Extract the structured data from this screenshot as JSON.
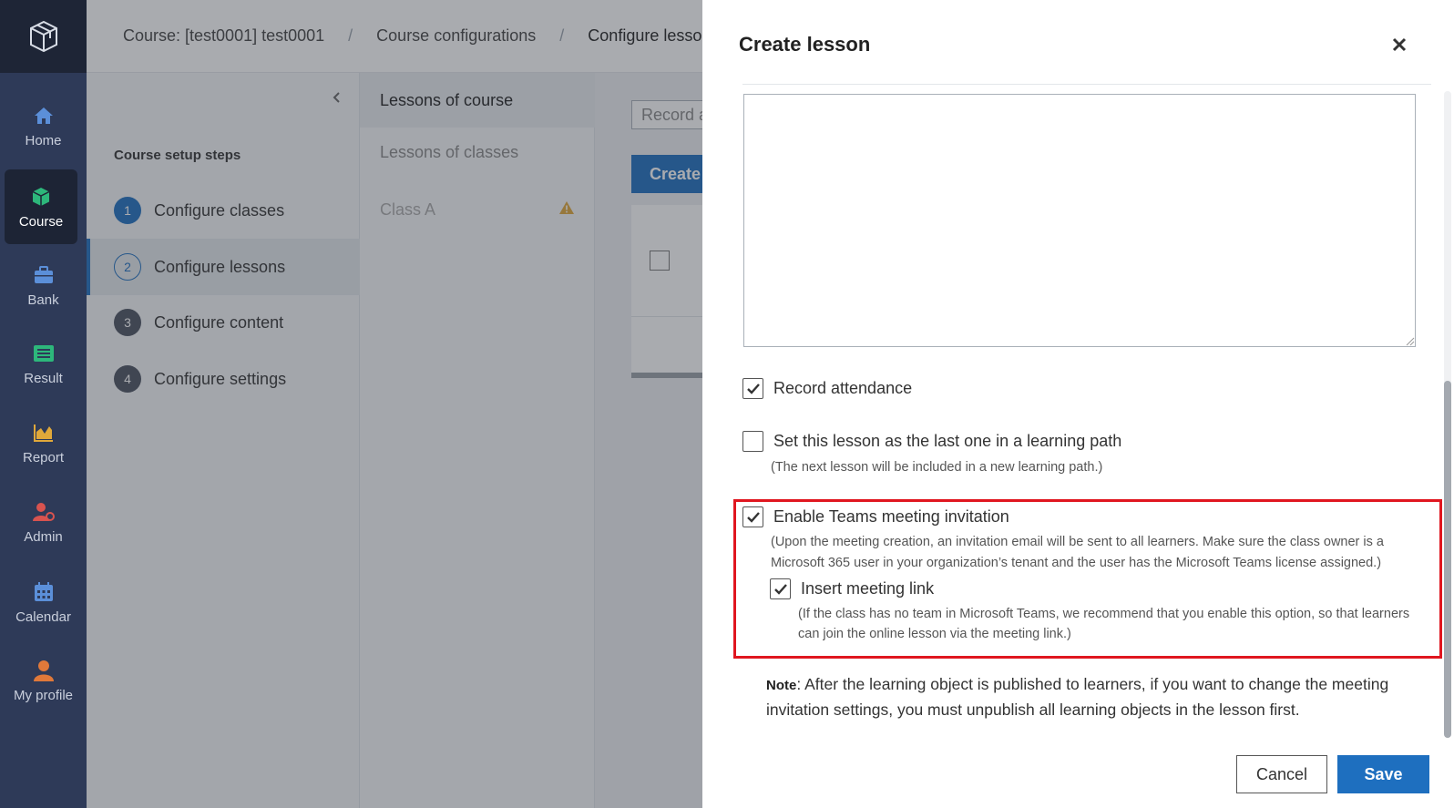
{
  "nav": {
    "items": [
      {
        "label": "Home",
        "icon": "home-icon",
        "color": "#5b8fd9"
      },
      {
        "label": "Course",
        "icon": "cube-icon",
        "color": "#2db77b"
      },
      {
        "label": "Bank",
        "icon": "briefcase-icon",
        "color": "#5b8fd9"
      },
      {
        "label": "Result",
        "icon": "list-icon",
        "color": "#2db77b"
      },
      {
        "label": "Report",
        "icon": "chart-icon",
        "color": "#e0a83a"
      },
      {
        "label": "Admin",
        "icon": "admin-icon",
        "color": "#d9534f"
      },
      {
        "label": "Calendar",
        "icon": "calendar-icon",
        "color": "#5b8fd9"
      },
      {
        "label": "My profile",
        "icon": "user-icon",
        "color": "#e0793a"
      }
    ]
  },
  "header": {
    "crumbs": [
      "Course: [test0001] test0001",
      "Course configurations",
      "Configure lessons"
    ]
  },
  "steps": {
    "title": "Course setup steps",
    "items": [
      {
        "num": "1",
        "label": "Configure classes"
      },
      {
        "num": "2",
        "label": "Configure lessons"
      },
      {
        "num": "3",
        "label": "Configure content"
      },
      {
        "num": "4",
        "label": "Configure settings"
      }
    ]
  },
  "lessons": {
    "tab_course": "Lessons of course",
    "tab_classes": "Lessons of classes",
    "class_a": "Class A"
  },
  "content": {
    "search_placeholder": "Record a",
    "create_label": "Create"
  },
  "drawer": {
    "title": "Create lesson",
    "record_attendance": "Record attendance",
    "last_lesson": "Set this lesson as the last one in a learning path",
    "last_lesson_hint": "(The next lesson will be included in a new learning path.)",
    "teams_invite": "Enable Teams meeting invitation",
    "teams_invite_hint_1": "(Upon the meeting creation, an invitation email will be sent to all learners. Make sure the class owner is a",
    "teams_invite_hint_2": "Microsoft 365 user in your organization’s tenant and the user has the Microsoft Teams license assigned.)",
    "meeting_link": "Insert meeting link",
    "meeting_link_hint_1": "(If the class has no team in Microsoft Teams, we recommend that you enable this option, so that learners",
    "meeting_link_hint_2": "can join the online lesson via the meeting link.)",
    "note_label": "Note",
    "note_text": ": After the learning object is published to learners, if you want to change the meeting invitation settings, you must unpublish all learning objects in the lesson first.",
    "cancel_label": "Cancel",
    "save_label": "Save"
  },
  "colors": {
    "accent": "#1e6fbf",
    "highlight": "#e0161f",
    "nav_bg": "#2e3a58"
  }
}
